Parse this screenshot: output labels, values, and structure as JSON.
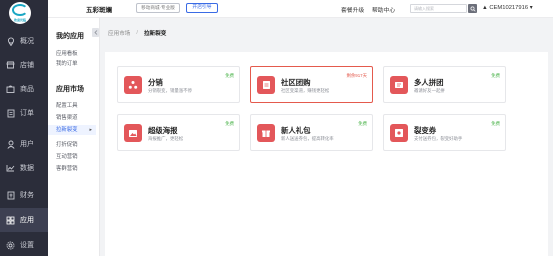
{
  "nav": {
    "logo_text": "欢迎光临",
    "items": [
      {
        "label": "概况",
        "icon": "location-icon"
      },
      {
        "label": "店铺",
        "icon": "store-icon"
      },
      {
        "label": "商品",
        "icon": "bag-icon"
      },
      {
        "label": "订单",
        "icon": "order-icon"
      },
      {
        "label": "用户",
        "icon": "user-icon"
      },
      {
        "label": "数据",
        "icon": "chart-icon"
      },
      {
        "label": "财务",
        "icon": "finance-icon"
      },
      {
        "label": "应用",
        "icon": "apps-icon"
      },
      {
        "label": "设置",
        "icon": "gear-icon"
      }
    ]
  },
  "side": {
    "section1_title": "我的应用",
    "section1_links": [
      "应用看板",
      "我的订单"
    ],
    "section2_title": "应用市场",
    "section2_links": [
      "配置工具",
      "销售渠道",
      "拉新裂变",
      "打折促销",
      "互动营销",
      "客群营销"
    ],
    "active_link": "拉新裂变"
  },
  "header": {
    "brand": "五彩斑斓",
    "tag_mode": "移动商城·专业版",
    "tag_upgrade": "开店引导",
    "link_upgrade": "套餐升级",
    "link_help": "帮助中心",
    "search_placeholder": "请输入搜索",
    "user_name": "CEM10217916"
  },
  "breadcrumb": {
    "root": "应用市场",
    "separator": "/",
    "current": "拉新裂变"
  },
  "cards": [
    {
      "title": "分销",
      "desc": "分销裂变，销量涨不停",
      "badge": "免费",
      "icon": "share-icon"
    },
    {
      "title": "社区团购",
      "desc": "社区变渠道，赚钱更轻松",
      "badge": "剩余917天",
      "icon": "document-icon"
    },
    {
      "title": "多人拼团",
      "desc": "邀请好友一起拼",
      "badge": "免费",
      "icon": "group-icon"
    },
    {
      "title": "超级海报",
      "desc": "海报推广，更轻松",
      "badge": "免费",
      "icon": "image-icon"
    },
    {
      "title": "新人礼包",
      "desc": "新人送送券包，提高转化率",
      "badge": "免费",
      "icon": "gift-icon"
    },
    {
      "title": "裂变券",
      "desc": "支付送券包，裂变好助手",
      "badge": "免费",
      "icon": "coupon-icon"
    }
  ],
  "colors": {
    "accent": "#3a6be5",
    "card_icon": "#e3575a",
    "free_badge": "#4bb34a",
    "sidebar_bg": "#2b2d3a"
  }
}
